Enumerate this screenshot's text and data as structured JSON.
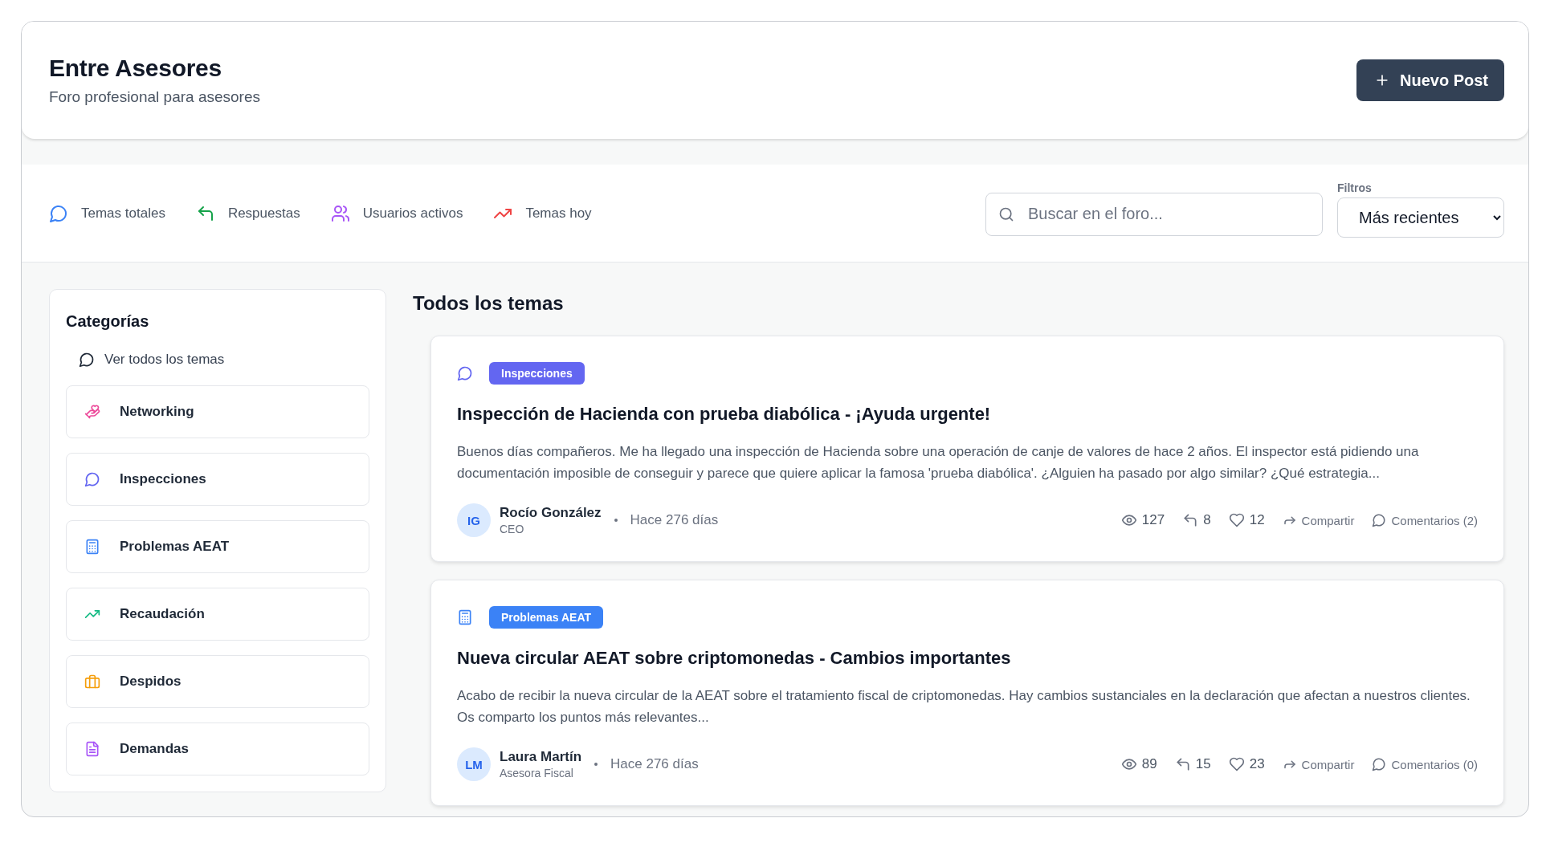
{
  "header": {
    "title": "Entre Asesores",
    "subtitle": "Foro profesional para asesores",
    "new_post_button": "Nuevo Post"
  },
  "stats": [
    {
      "label": "Temas totales",
      "color": "#3b82f6"
    },
    {
      "label": "Respuestas",
      "color": "#16a34a"
    },
    {
      "label": "Usuarios activos",
      "color": "#a855f7"
    },
    {
      "label": "Temas hoy",
      "color": "#ef4444"
    }
  ],
  "search": {
    "placeholder": "Buscar en el foro..."
  },
  "filters": {
    "label": "Filtros",
    "value": "Más recientes"
  },
  "sidebar": {
    "title": "Categorías",
    "all_link": "Ver todos los temas",
    "categories": [
      {
        "label": "Networking",
        "color": "#ec4899"
      },
      {
        "label": "Inspecciones",
        "color": "#6366f1"
      },
      {
        "label": "Problemas AEAT",
        "color": "#3b82f6"
      },
      {
        "label": "Recaudación",
        "color": "#10b981"
      },
      {
        "label": "Despidos",
        "color": "#f59e0b"
      },
      {
        "label": "Demandas",
        "color": "#a855f7"
      }
    ]
  },
  "topics": {
    "title": "Todos los temas",
    "posts": [
      {
        "category": "Inspecciones",
        "color": "#6366f1",
        "title": "Inspección de Hacienda con prueba diabólica - ¡Ayuda urgente!",
        "excerpt": "Buenos días compañeros. Me ha llegado una inspección de Hacienda sobre una operación de canje de valores de hace 2 años. El inspector está pidiendo una documentación imposible de conseguir y parece que quiere aplicar la famosa 'prueba diabólica'. ¿Alguien ha pasado por algo similar? ¿Qué estrategia...",
        "author": {
          "initials": "IG",
          "name": "Rocío González",
          "role": "CEO"
        },
        "time": "Hace 276 días",
        "views": "127",
        "replies": "8",
        "likes": "12",
        "share": "Compartir",
        "comments": "Comentarios (2)"
      },
      {
        "category": "Problemas AEAT",
        "color": "#3b82f6",
        "title": "Nueva circular AEAT sobre criptomonedas - Cambios importantes",
        "excerpt": "Acabo de recibir la nueva circular de la AEAT sobre el tratamiento fiscal de criptomonedas. Hay cambios sustanciales en la declaración que afectan a nuestros clientes. Os comparto los puntos más relevantes...",
        "author": {
          "initials": "LM",
          "name": "Laura Martín",
          "role": "Asesora Fiscal"
        },
        "time": "Hace 276 días",
        "views": "89",
        "replies": "15",
        "likes": "23",
        "share": "Compartir",
        "comments": "Comentarios (0)"
      }
    ]
  }
}
